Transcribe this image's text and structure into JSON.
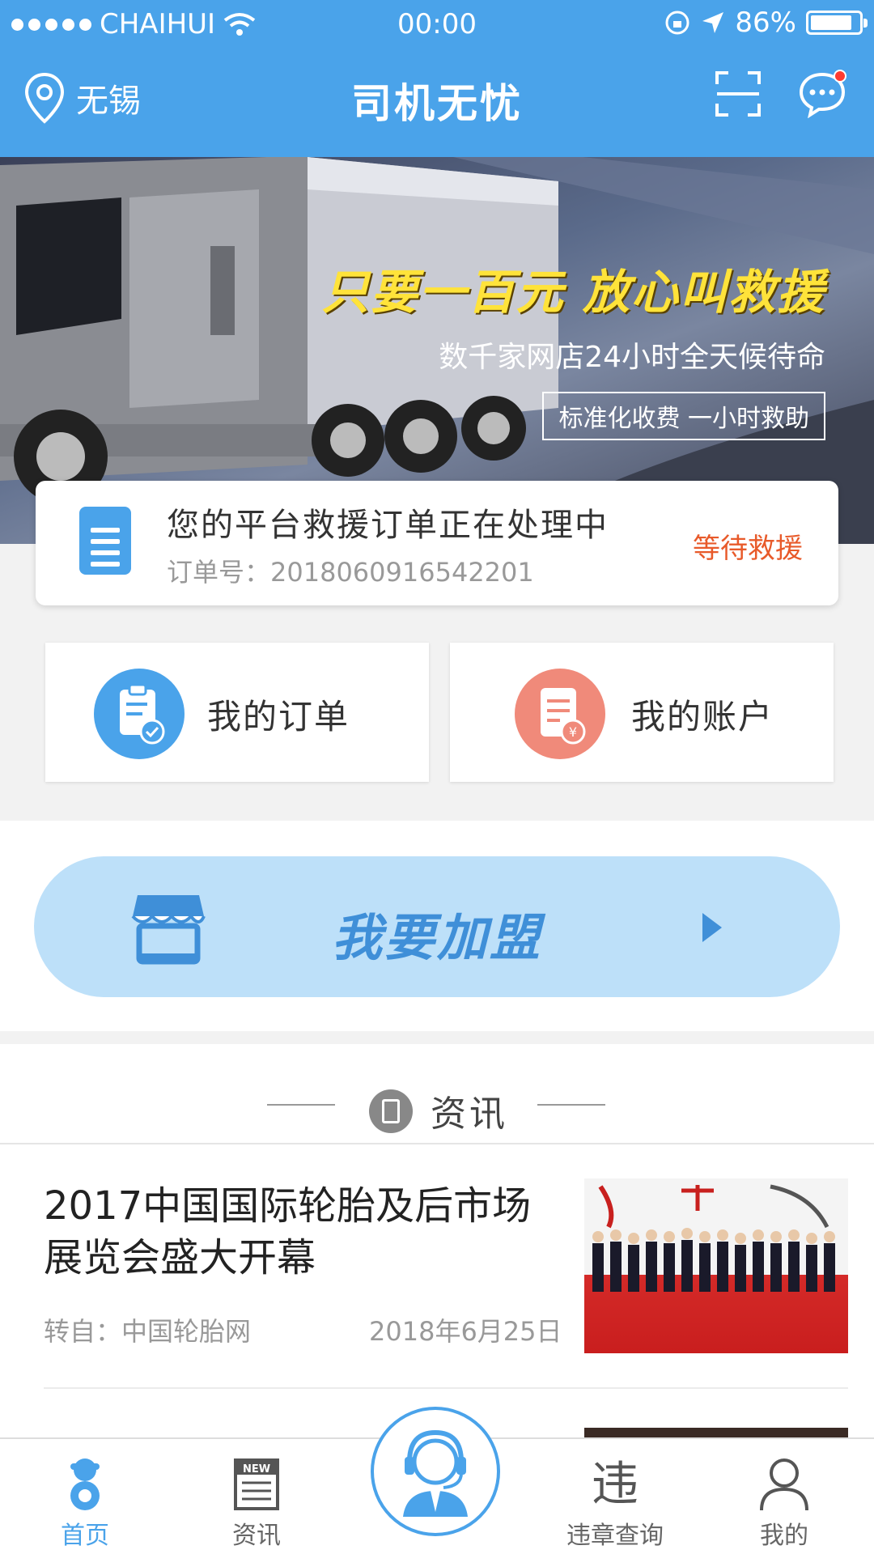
{
  "status_bar": {
    "carrier": "CHAIHUI",
    "time": "00:00",
    "battery": "86%"
  },
  "nav": {
    "location": "无锡",
    "title": "司机无忧"
  },
  "banner": {
    "headline": "只要一百元 放心叫救援",
    "subline": "数千家网店24小时全天候待命",
    "boxed": "标准化收费 一小时救助"
  },
  "order_card": {
    "title": "您的平台救援订单正在处理中",
    "order_no": "订单号：2018060916542201",
    "status": "等待救援",
    "status_color": "#e85a2a"
  },
  "quick_actions": [
    {
      "label": "我的订单",
      "color": "#4aa3ea",
      "icon": "clipboard-check-icon"
    },
    {
      "label": "我的账户",
      "color": "#f08a7a",
      "icon": "bill-yuan-icon"
    }
  ],
  "join": {
    "label": "我要加盟"
  },
  "news": {
    "section_title": "资讯",
    "items": [
      {
        "title": "2017中国国际轮胎及后市场展览会盛大开幕",
        "source": "转自：中国轮胎网",
        "date": "2018年6月25日"
      }
    ]
  },
  "tabbar": {
    "tabs": [
      {
        "label": "首页",
        "active": true
      },
      {
        "label": "资讯",
        "active": false
      },
      {
        "label": "违章查询",
        "active": false
      },
      {
        "label": "我的",
        "active": false
      }
    ],
    "accent": "#4aa3ea"
  }
}
